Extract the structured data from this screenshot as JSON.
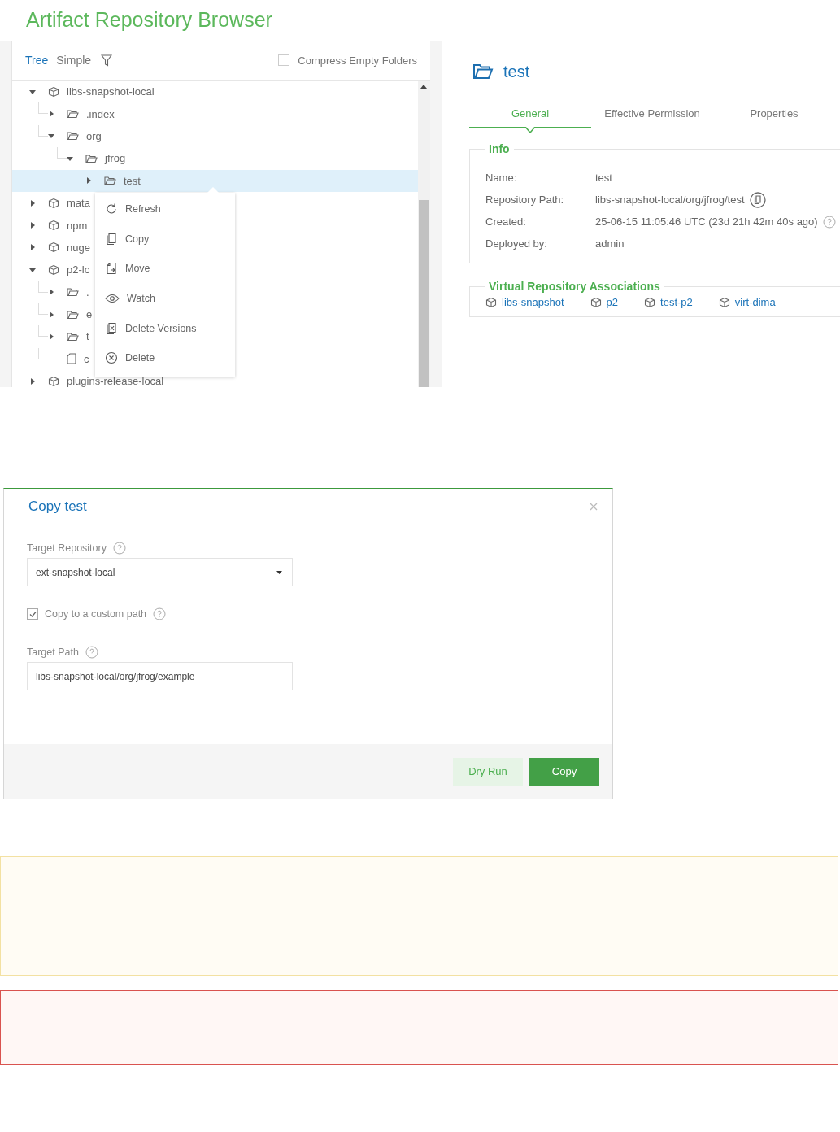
{
  "app_title": "Artifact Repository Browser",
  "tree_panel": {
    "view_tabs": [
      {
        "label": "Tree",
        "selected": true
      },
      {
        "label": "Simple",
        "selected": false
      }
    ],
    "compress_empty_folders": {
      "label": "Compress Empty Folders",
      "checked": false
    },
    "nodes": [
      {
        "kind": "repo",
        "label": "libs-snapshot-local",
        "expanded": true,
        "selected": false,
        "children": [
          {
            "kind": "folder",
            "label": ".index",
            "expanded": false,
            "selected": false
          },
          {
            "kind": "folder",
            "label": "org",
            "expanded": true,
            "selected": false,
            "children": [
              {
                "kind": "folder",
                "label": "jfrog",
                "expanded": true,
                "selected": false,
                "children": [
                  {
                    "kind": "folder",
                    "label": "test",
                    "expanded": false,
                    "selected": true
                  }
                ]
              }
            ]
          }
        ]
      },
      {
        "kind": "repo",
        "label": "mata",
        "expanded": false,
        "selected": false
      },
      {
        "kind": "repo",
        "label": "npm",
        "expanded": false,
        "selected": false
      },
      {
        "kind": "repo",
        "label": "nuge",
        "expanded": false,
        "selected": false
      },
      {
        "kind": "repo",
        "label": "p2-lc",
        "expanded": true,
        "selected": false,
        "children": [
          {
            "kind": "folder",
            "label": ".",
            "expanded": false,
            "selected": false
          },
          {
            "kind": "folder",
            "label": "e",
            "expanded": false,
            "selected": false
          },
          {
            "kind": "folder",
            "label": "t",
            "expanded": false,
            "selected": false
          },
          {
            "kind": "file",
            "label": "c",
            "selected": false
          }
        ]
      },
      {
        "kind": "repo",
        "label": "plugins-release-local",
        "expanded": false,
        "selected": false
      }
    ]
  },
  "context_menu": {
    "items": [
      {
        "kind": "refresh",
        "label": "Refresh"
      },
      {
        "kind": "copy",
        "label": "Copy"
      },
      {
        "kind": "move",
        "label": "Move"
      },
      {
        "kind": "watch",
        "label": "Watch"
      },
      {
        "kind": "delete-versions",
        "label": "Delete Versions"
      },
      {
        "kind": "delete",
        "label": "Delete"
      }
    ]
  },
  "details": {
    "title": "test",
    "tabs": [
      {
        "label": "General",
        "selected": true
      },
      {
        "label": "Effective Permission",
        "selected": false
      },
      {
        "label": "Properties",
        "selected": false
      }
    ],
    "info": {
      "legend": "Info",
      "rows": [
        {
          "kind": "plain",
          "label": "Name:",
          "value": "test"
        },
        {
          "kind": "copyable",
          "label": "Repository Path:",
          "value": "libs-snapshot-local/org/jfrog/test"
        },
        {
          "kind": "help",
          "label": "Created:",
          "value": "25-06-15 11:05:46 UTC (23d 21h 42m 40s ago)"
        },
        {
          "kind": "plain",
          "label": "Deployed by:",
          "value": "admin"
        }
      ]
    },
    "associations": {
      "legend": "Virtual Repository Associations",
      "links": [
        "libs-snapshot",
        "p2",
        "test-p2",
        "virt-dima"
      ]
    }
  },
  "copy_dialog": {
    "title": "Copy test",
    "target_repository": {
      "label": "Target Repository",
      "value": "ext-snapshot-local"
    },
    "custom_path": {
      "label": "Copy to a custom path",
      "checked": true
    },
    "target_path": {
      "label": "Target Path",
      "value": "libs-snapshot-local/org/jfrog/example"
    },
    "buttons": [
      {
        "kind": "secondary",
        "label": "Dry Run"
      },
      {
        "kind": "primary",
        "label": "Copy"
      }
    ]
  },
  "notices": [
    {
      "kind": "warning"
    },
    {
      "kind": "error"
    }
  ]
}
